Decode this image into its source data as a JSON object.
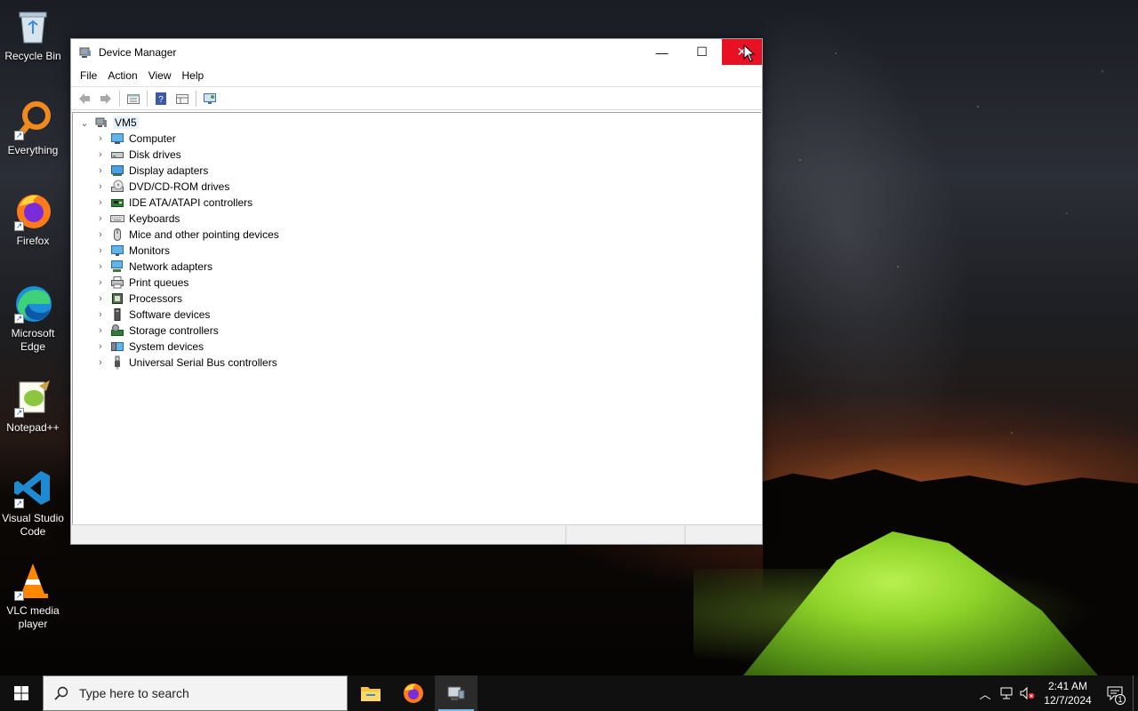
{
  "desktop": {
    "icons": [
      {
        "label": "Recycle Bin",
        "icon": "recycle-bin-icon"
      },
      {
        "label": "Everything",
        "icon": "everything-search-icon"
      },
      {
        "label": "Firefox",
        "icon": "firefox-icon"
      },
      {
        "label": "Microsoft Edge",
        "icon": "edge-icon"
      },
      {
        "label": "Notepad++",
        "icon": "notepadpp-icon"
      },
      {
        "label": "Visual Studio Code",
        "icon": "vscode-icon"
      },
      {
        "label": "VLC media player",
        "icon": "vlc-icon"
      }
    ]
  },
  "window": {
    "title": "Device Manager",
    "controls": {
      "minimize": "—",
      "maximize": "☐",
      "close": "✕"
    },
    "menu": [
      "File",
      "Action",
      "View",
      "Help"
    ],
    "toolbar": [
      "back-arrow-icon",
      "forward-arrow-icon",
      "properties-icon",
      "help-icon",
      "show-hidden-icon",
      "scan-hardware-icon"
    ],
    "tree": {
      "root": "VM5",
      "children": [
        {
          "label": "Computer",
          "icon": "computer-icon"
        },
        {
          "label": "Disk drives",
          "icon": "disk-drive-icon"
        },
        {
          "label": "Display adapters",
          "icon": "display-adapter-icon"
        },
        {
          "label": "DVD/CD-ROM drives",
          "icon": "dvd-drive-icon"
        },
        {
          "label": "IDE ATA/ATAPI controllers",
          "icon": "ide-controller-icon"
        },
        {
          "label": "Keyboards",
          "icon": "keyboard-icon"
        },
        {
          "label": "Mice and other pointing devices",
          "icon": "mouse-icon"
        },
        {
          "label": "Monitors",
          "icon": "monitor-icon"
        },
        {
          "label": "Network adapters",
          "icon": "network-adapter-icon"
        },
        {
          "label": "Print queues",
          "icon": "printer-icon"
        },
        {
          "label": "Processors",
          "icon": "processor-icon"
        },
        {
          "label": "Software devices",
          "icon": "software-device-icon"
        },
        {
          "label": "Storage controllers",
          "icon": "storage-controller-icon"
        },
        {
          "label": "System devices",
          "icon": "system-device-icon"
        },
        {
          "label": "Universal Serial Bus controllers",
          "icon": "usb-icon"
        }
      ]
    }
  },
  "taskbar": {
    "search_placeholder": "Type here to search",
    "apps": [
      "file-explorer-icon",
      "firefox-icon",
      "device-manager-icon"
    ],
    "clock_time": "2:41 AM",
    "clock_date": "12/7/2024",
    "notification_count": "1"
  },
  "colors": {
    "close_button": "#e81123",
    "selection": "#e5f1fb",
    "taskbar": "#101010",
    "active_app_indicator": "#76b9ed"
  }
}
